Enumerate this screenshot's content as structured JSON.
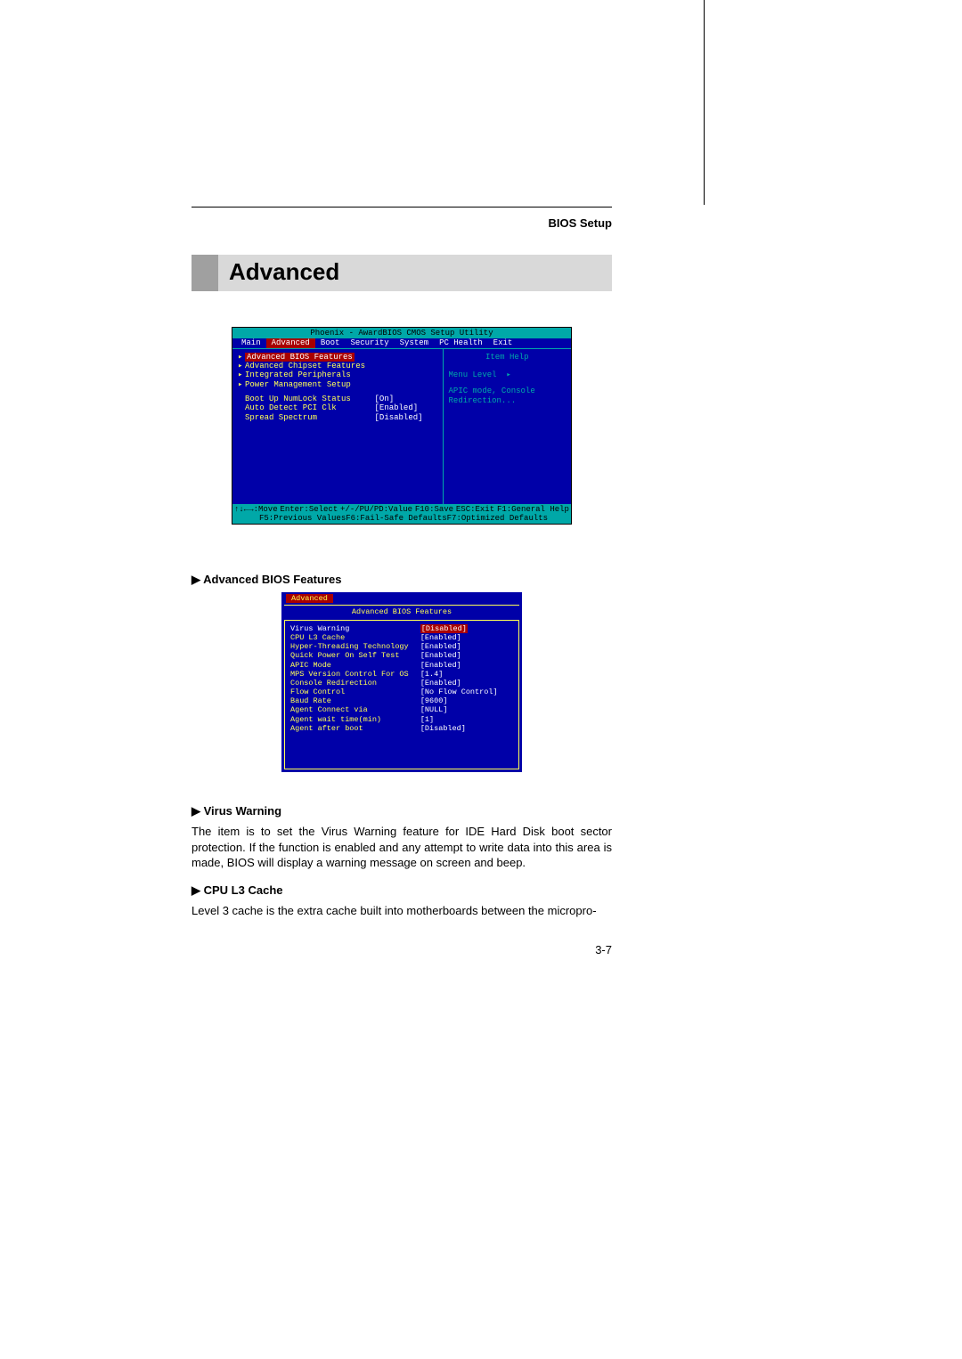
{
  "header": {
    "right": "BIOS Setup",
    "title": "Advanced"
  },
  "bios_main": {
    "title": "Phoenix - AwardBIOS CMOS Setup Utility",
    "menu": [
      "Main",
      "Advanced",
      "Boot",
      "Security",
      "System",
      "PC Health",
      "Exit"
    ],
    "menu_selected": "Advanced",
    "left_submenus": [
      "Advanced BIOS Features",
      "Advanced Chipset Features",
      "Integrated Peripherals",
      "Power Management Setup"
    ],
    "left_settings": [
      {
        "label": "Boot Up NumLock Status",
        "value": "[On]"
      },
      {
        "label": "Auto Detect PCI Clk",
        "value": "[Enabled]"
      },
      {
        "label": "Spread Spectrum",
        "value": "[Disabled]"
      }
    ],
    "help_header": "Item Help",
    "menu_level_label": "Menu Level",
    "menu_level_arrow": "▸",
    "help_text": "APIC mode, Console Redirection...",
    "footer_line1": [
      "↑↓←→:Move",
      "Enter:Select",
      "+/-/PU/PD:Value",
      "F10:Save",
      "ESC:Exit",
      "F1:General Help"
    ],
    "footer_line2": [
      "F5:Previous Values",
      "F6:Fail-Safe Defaults",
      "F7:Optimized Defaults"
    ]
  },
  "section1": {
    "heading": "Advanced BIOS Features",
    "arrow": "▶"
  },
  "bios_sub": {
    "tab": "Advanced",
    "title": "Advanced BIOS Features",
    "rows": [
      {
        "label": "Virus Warning",
        "value": "[Disabled]",
        "selected": true
      },
      {
        "label": "CPU L3 Cache",
        "value": "[Enabled]"
      },
      {
        "label": "Hyper-Threading Technology",
        "value": "[Enabled]"
      },
      {
        "label": "Quick Power On Self Test",
        "value": "[Enabled]"
      },
      {
        "label": "APIC Mode",
        "value": "[Enabled]"
      },
      {
        "label": "MPS Version Control For OS",
        "value": "[1.4]"
      },
      {
        "label": "Console Redirection",
        "value": "[Enabled]"
      },
      {
        "label": "Flow Control",
        "value": "[No Flow Control]"
      },
      {
        "label": "Baud Rate",
        "value": "[9600]"
      },
      {
        "label": "Agent Connect via",
        "value": "[NULL]"
      },
      {
        "label": "Agent wait time(min)",
        "value": "[1]"
      },
      {
        "label": "Agent after boot",
        "value": "[Disabled]"
      }
    ]
  },
  "section2": {
    "heading": "Virus Warning",
    "arrow": "▶",
    "text": "The item is to set the Virus Warning feature for IDE Hard Disk boot sector protection. If the function is enabled and any attempt to write data into this area is made, BIOS will display a warning message on screen and beep."
  },
  "section3": {
    "heading": "CPU L3 Cache",
    "arrow": "▶",
    "text": "Level 3 cache is the extra cache built into motherboards between the micropro-"
  },
  "page_number": "3-7"
}
